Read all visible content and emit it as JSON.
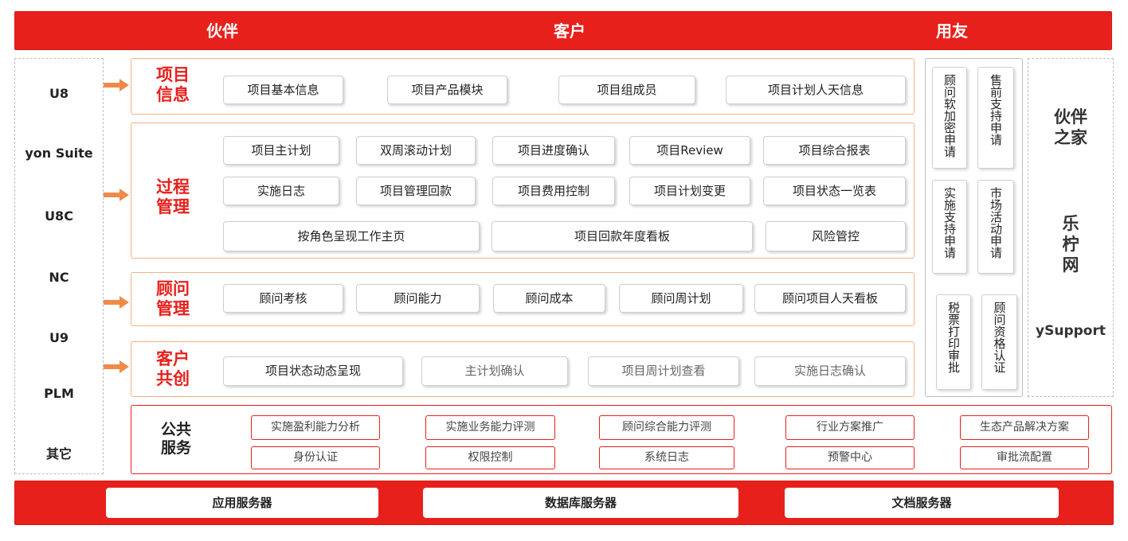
{
  "header": {
    "left": "伙伴",
    "center": "客户",
    "right": "用友"
  },
  "systems": [
    "U8",
    "yon Suite",
    "U8C",
    "NC",
    "U9",
    "PLM",
    "其它"
  ],
  "sections": {
    "project_info": {
      "title_line1": "项目",
      "title_line2": "信息",
      "items": [
        "项目基本信息",
        "项目产品模块",
        "项目组成员",
        "项目计划人天信息"
      ]
    },
    "process_mgmt": {
      "title_line1": "过程",
      "title_line2": "管理",
      "row1": [
        "项目主计划",
        "双周滚动计划",
        "项目进度确认",
        "项目Review",
        "项目综合报表"
      ],
      "row2": [
        "实施日志",
        "项目管理回款",
        "项目费用控制",
        "项目计划变更",
        "项目状态一览表"
      ],
      "row3": [
        "按角色呈现工作主页",
        "项目回款年度看板",
        "风险管控"
      ]
    },
    "consultant_mgmt": {
      "title_line1": "顾问",
      "title_line2": "管理",
      "items": [
        "顾问考核",
        "顾问能力",
        "顾问成本",
        "顾问周计划",
        "顾问项目人天看板"
      ]
    },
    "customer_cocreate": {
      "title_line1": "客户",
      "title_line2": "共创",
      "items": [
        "项目状态动态呈现",
        "主计划确认",
        "项目周计划查看",
        "实施日志确认"
      ]
    },
    "public_services": {
      "title_line1": "公共",
      "title_line2": "服务",
      "row1": [
        "实施盈利能力分析",
        "实施业务能力评测",
        "顾问综合能力评测",
        "行业方案推广",
        "生态产品解决方案"
      ],
      "row2": [
        "身份认证",
        "权限控制",
        "系统日志",
        "预警中心",
        "审批流配置"
      ]
    }
  },
  "yonyou_apps": [
    "顾问软加密申请",
    "售前支持申请",
    "实施支持申请",
    "市场活动申请",
    "税票打印审批",
    "顾问资格认证"
  ],
  "partner": {
    "line1": "伙伴",
    "line2": "之家",
    "lele_1": "乐",
    "lele_2": "柠",
    "lele_3": "网",
    "ysupport": "ySupport"
  },
  "servers": [
    "应用服务器",
    "数据库服务器",
    "文档服务器"
  ],
  "colors": {
    "red": "#e8201c",
    "orange_border": "#f4b183",
    "arrow": "#f08a4a"
  }
}
